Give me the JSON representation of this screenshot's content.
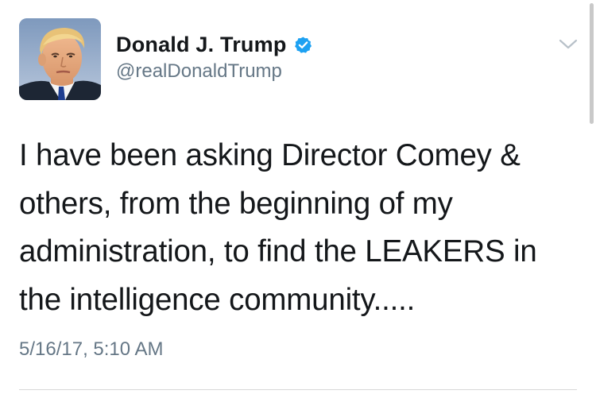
{
  "tweet": {
    "display_name": "Donald J. Trump",
    "handle": "@realDonaldTrump",
    "verified": true,
    "avatar_icon": "profile-photo",
    "text_lines": [
      "I have been asking Director Comey &",
      "others, from the beginning of my",
      "administration, to find the LEAKERS in",
      "the intelligence community....."
    ],
    "timestamp": "5/16/17, 5:10 AM"
  },
  "colors": {
    "verified_blue": "#1da1f2",
    "secondary_text": "#657786",
    "primary_text": "#14171a"
  },
  "icons": {
    "verified": "verified-badge-icon",
    "menu": "chevron-down-icon"
  }
}
